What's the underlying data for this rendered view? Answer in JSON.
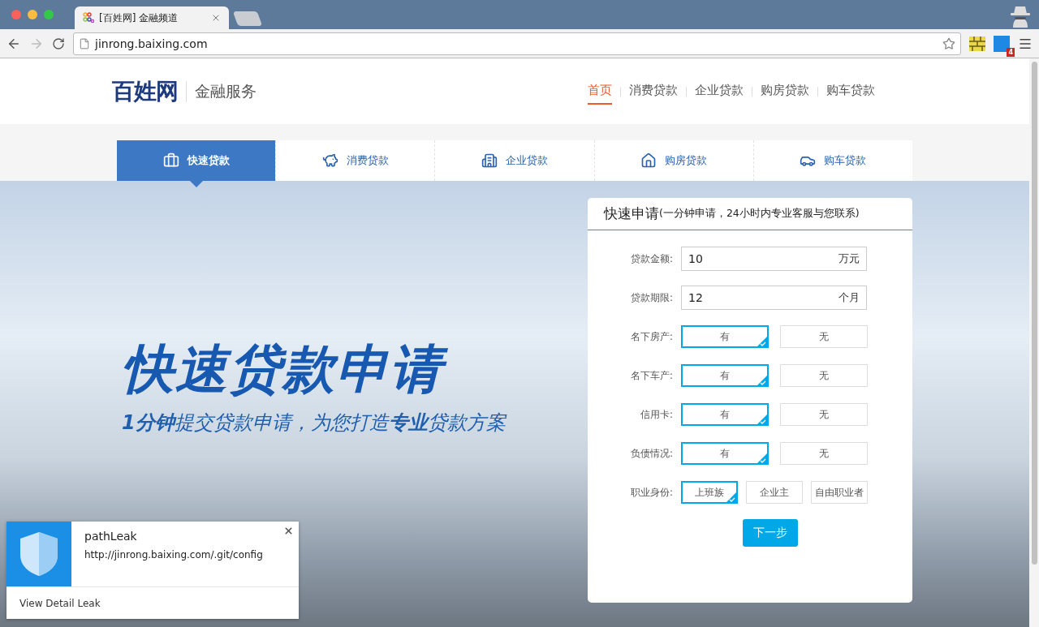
{
  "browser": {
    "tab_title": "[百姓网] 金融频道",
    "url": "jinrong.baixing.com",
    "extension_badge": "4"
  },
  "header": {
    "logo": "百姓网",
    "service": "金融服务",
    "nav": [
      {
        "label": "首页",
        "selected": true
      },
      {
        "label": "消费贷款",
        "selected": false
      },
      {
        "label": "企业贷款",
        "selected": false
      },
      {
        "label": "购房贷款",
        "selected": false
      },
      {
        "label": "购车贷款",
        "selected": false
      }
    ]
  },
  "product_tabs": [
    {
      "label": "快速贷款",
      "selected": true
    },
    {
      "label": "消费贷款",
      "selected": false
    },
    {
      "label": "企业贷款",
      "selected": false
    },
    {
      "label": "购房贷款",
      "selected": false
    },
    {
      "label": "购车贷款",
      "selected": false
    }
  ],
  "hero": {
    "title": "快速贷款申请",
    "subtitle": "**1分钟**提交贷款申请，为您打造**专业**贷款方案"
  },
  "form": {
    "title": "快速申请",
    "note": "(一分钟申请，24小时内专业客服与您联系)",
    "fields": [
      {
        "kind": "input",
        "label": "贷款金额:",
        "value": "10",
        "unit": "万元"
      },
      {
        "kind": "input",
        "label": "贷款期限:",
        "value": "12",
        "unit": "个月"
      },
      {
        "kind": "choice",
        "label": "名下房产:",
        "options": [
          {
            "label": "有",
            "selected": true
          },
          {
            "label": "无",
            "selected": false
          }
        ]
      },
      {
        "kind": "choice",
        "label": "名下车产:",
        "options": [
          {
            "label": "有",
            "selected": true
          },
          {
            "label": "无",
            "selected": false
          }
        ]
      },
      {
        "kind": "choice",
        "label": "信用卡:",
        "options": [
          {
            "label": "有",
            "selected": true
          },
          {
            "label": "无",
            "selected": false
          }
        ]
      },
      {
        "kind": "choice",
        "label": "负债情况:",
        "options": [
          {
            "label": "有",
            "selected": true
          },
          {
            "label": "无",
            "selected": false
          }
        ]
      },
      {
        "kind": "choice",
        "label": "职业身份:",
        "options": [
          {
            "label": "上班族",
            "selected": true
          },
          {
            "label": "企业主",
            "selected": false
          },
          {
            "label": "自由职业者",
            "selected": false
          }
        ]
      }
    ],
    "submit": "下一步"
  },
  "notification": {
    "title": "pathLeak",
    "url": "http://jinrong.baixing.com/.git/config",
    "link": "View Detail Leak"
  }
}
